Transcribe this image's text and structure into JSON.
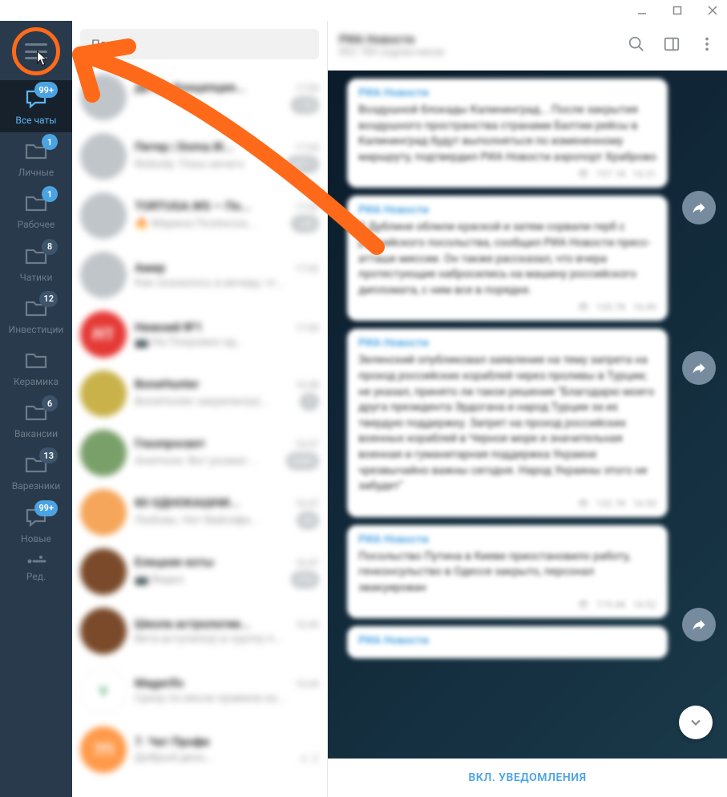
{
  "window": {
    "title": ""
  },
  "search": {
    "placeholder": "Поиск"
  },
  "folders": [
    {
      "id": "all",
      "label": "Все чаты",
      "badge": "99+",
      "icon": "chat",
      "active": true
    },
    {
      "id": "personal",
      "label": "Личные",
      "badge": "1",
      "icon": "folder"
    },
    {
      "id": "work",
      "label": "Рабочее",
      "badge": "1",
      "icon": "folder"
    },
    {
      "id": "chats2",
      "label": "Чатики",
      "badge": "8",
      "dark": true,
      "icon": "folder"
    },
    {
      "id": "invest",
      "label": "Инвестиции",
      "badge": "12",
      "dark": true,
      "icon": "folder"
    },
    {
      "id": "ceramic",
      "label": "Керамика",
      "badge": "",
      "icon": "folder"
    },
    {
      "id": "vac",
      "label": "Вакансии",
      "badge": "6",
      "dark": true,
      "icon": "folder"
    },
    {
      "id": "var",
      "label": "Варезники",
      "badge": "13",
      "dark": true,
      "icon": "folder"
    },
    {
      "id": "new",
      "label": "Новые",
      "badge": "99+",
      "icon": "chat"
    }
  ],
  "edit_label": "Ред.",
  "chats": [
    {
      "name": "ДЕТИ. Концепция...",
      "preview": "",
      "time": "17:05",
      "badge": "116"
    },
    {
      "name": "Питер | Doma.IK...",
      "preview": "Nobody: Пока ничего",
      "time": "17:03",
      "badge": "6571"
    },
    {
      "name": "TORTUGA.WS — По...",
      "preview": "🔥 Марина Полянска...",
      "time": "17:02",
      "badge": "145"
    },
    {
      "name": "Амир",
      "preview": "Как оказалось в вечеру, чт...",
      "time": "17:02",
      "badge": ""
    },
    {
      "name": "Нижний №1",
      "preview": "📷 На Покровке од...",
      "time": "17:00",
      "badge": ""
    },
    {
      "name": "BoneHunter",
      "preview": "BoneHunter закрепил(а)...",
      "time": "16:58",
      "badge": "7"
    },
    {
      "name": "Глазпросвет",
      "preview": "Anemone: Вот розжиг...",
      "time": "16:57",
      "badge": "0385"
    },
    {
      "name": "80 ОДНОКАШНИ...",
      "preview": "Любовь: Нет Вайсефа...",
      "time": "16:47",
      "badge": "63"
    },
    {
      "name": "Елецкие коты",
      "preview": "📷 Видео",
      "time": "16:47",
      "badge": "970"
    },
    {
      "name": "Школа астрологии...",
      "preview": "Вета вступил(а) в группу п...",
      "time": "16:45",
      "badge": ""
    },
    {
      "name": "Magerifo",
      "preview": "Сразу по весне правила ка...",
      "time": "16:44",
      "badge": ""
    },
    {
      "name": "7. Чат Профи",
      "preview": "Добрый день...",
      "time": "",
      "badge": "",
      "pin_count": "2"
    }
  ],
  "header": {
    "title": "РИА Новости",
    "subtitle": "892 789 подписчиков"
  },
  "messages": [
    {
      "link": "РИА Новости",
      "text": "Воздушной блокады Калининград... После закрытия воздушного пространства странами Балтии рейсы в Калининград будут выполняться по измененному маршруту, подтвердил РИА Новости аэропорт Храброво",
      "views": "197.1K",
      "time": "16:31"
    },
    {
      "link": "РИА Новости",
      "text": "В Дублине облили краской и затем сорвали герб с российского посольства, сообщил РИА Новости пресс-атташе миссии. Он также рассказал, что вчера протестующие набросились на машину российского дипломата, с ним все в порядке.",
      "views": "133.7K",
      "time": "16:49"
    },
    {
      "link": "РИА Новости",
      "text": "Зеленский опубликовал заявление на тему запрета на проход российских кораблей через проливы в Турции; не указал, принято ли такое решение\n\n\"Благодарю моего друга президента Эрдогана и народ Турции за их твердую поддержку. Запрет на проход российских военных кораблей в Черное море и значительная военная и гуманитарная поддержка Украине чрезвычайно важны сегодня. Народ Украины этого не забудет\"",
      "views": "132.7K",
      "time": "16:50"
    },
    {
      "link": "РИА Новости",
      "text": "Посольство Путина в Киеве приостановило работу, генконсульство в Одессе закрыто, персонал эвакуирован",
      "views": "119.6K",
      "time": "16:52"
    },
    {
      "link": "РИА Новости",
      "text": "",
      "views": "",
      "time": ""
    }
  ],
  "notif_button": "ВКЛ. УВЕДОМЛЕНИЯ",
  "avatar_7p": "7П"
}
